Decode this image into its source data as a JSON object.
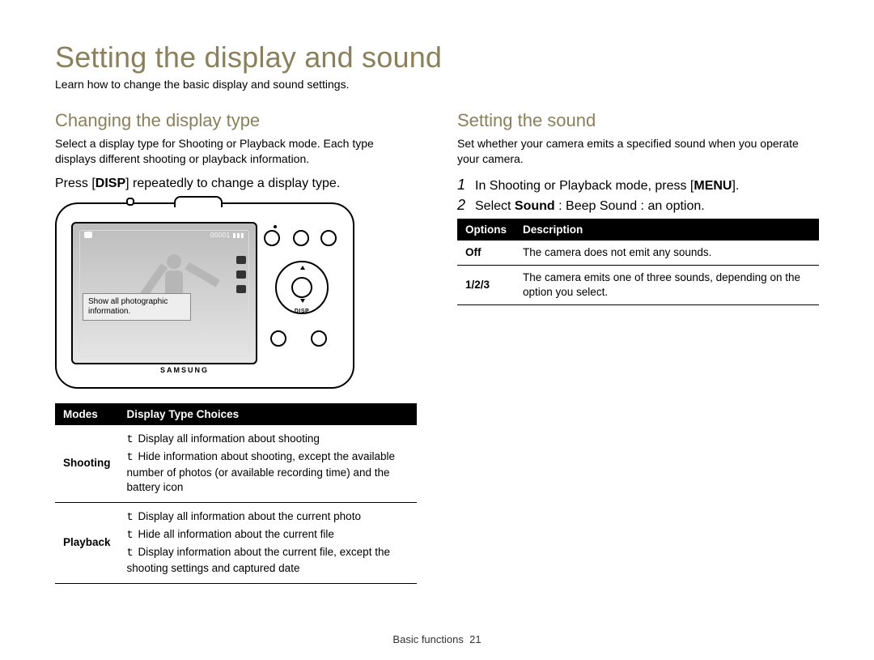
{
  "page_title": "Setting the display and sound",
  "page_subtitle": "Learn how to change the basic display and sound settings.",
  "left": {
    "section_title": "Changing the display type",
    "section_desc": "Select a display type for Shooting or Playback mode. Each type displays different shooting or playback information.",
    "instruction_pre": "Press [",
    "instruction_kw": "DISP",
    "instruction_post": "] repeatedly to change a display type.",
    "camera_callout": "Show all photographic information.",
    "camera_counter": "00001",
    "camera_brand": "SAMSUNG",
    "camera_disp": "DISP",
    "table_headers": {
      "modes": "Modes",
      "choices": "Display Type Choices"
    },
    "rows": [
      {
        "mode": "Shooting",
        "items": [
          "Display all information about shooting",
          "Hide information about shooting, except the available number of photos (or available recording time) and the battery icon"
        ]
      },
      {
        "mode": "Playback",
        "items": [
          "Display all information about the current photo",
          "Hide all information about the current file",
          "Display information about the current file, except the shooting settings and captured date"
        ]
      }
    ]
  },
  "right": {
    "section_title": "Setting the sound",
    "section_desc": "Set whether your camera emits a specified sound when you operate your camera.",
    "steps": [
      {
        "num": "1",
        "pre": "In Shooting or Playback mode, press [",
        "kw": "MENU",
        "post": "]."
      },
      {
        "num": "2",
        "pre": "Select ",
        "kw": "Sound",
        "mid": "  :  Beep Sound  :  an option.",
        "post": ""
      }
    ],
    "table_headers": {
      "options": "Options",
      "description": "Description"
    },
    "rows": [
      {
        "opt": "Off",
        "desc": "The camera does not emit any sounds."
      },
      {
        "opt": "1/2/3",
        "desc": "The camera emits one of three sounds, depending on the option you select."
      }
    ]
  },
  "footer": {
    "section": "Basic functions",
    "page": "21"
  }
}
